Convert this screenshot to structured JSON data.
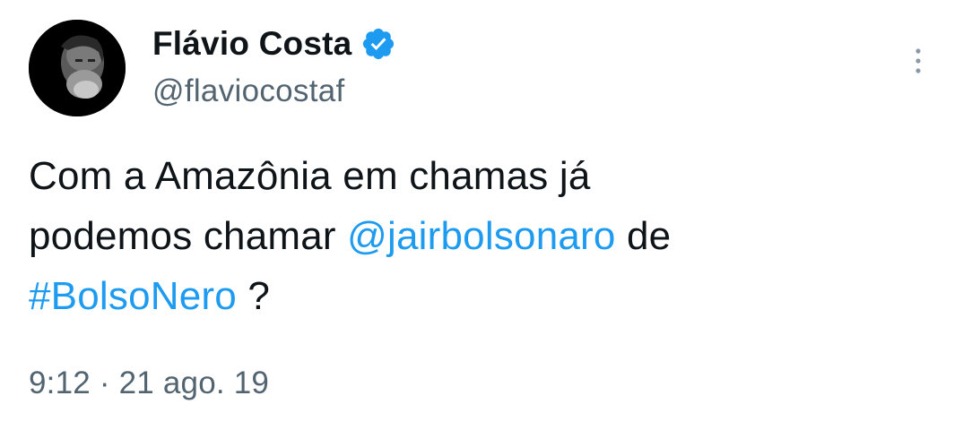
{
  "author": {
    "display_name": "Flávio Costa",
    "handle": "@flaviocostaf",
    "verified_icon": "verified-badge-icon",
    "verified_color": "#1d9bf0"
  },
  "tweet": {
    "line1": "Com a Amazônia em chamas já",
    "line2_prefix": "podemos chamar ",
    "mention": "@jairbolsonaro",
    "line2_suffix": " de",
    "hashtag": "#BolsoNero",
    "line3_suffix": " ?",
    "link_color": "#1d9bf0"
  },
  "meta": {
    "timestamp": "9:12 · 21 ago. 19"
  },
  "menu": {
    "icon": "more-vertical-icon"
  }
}
